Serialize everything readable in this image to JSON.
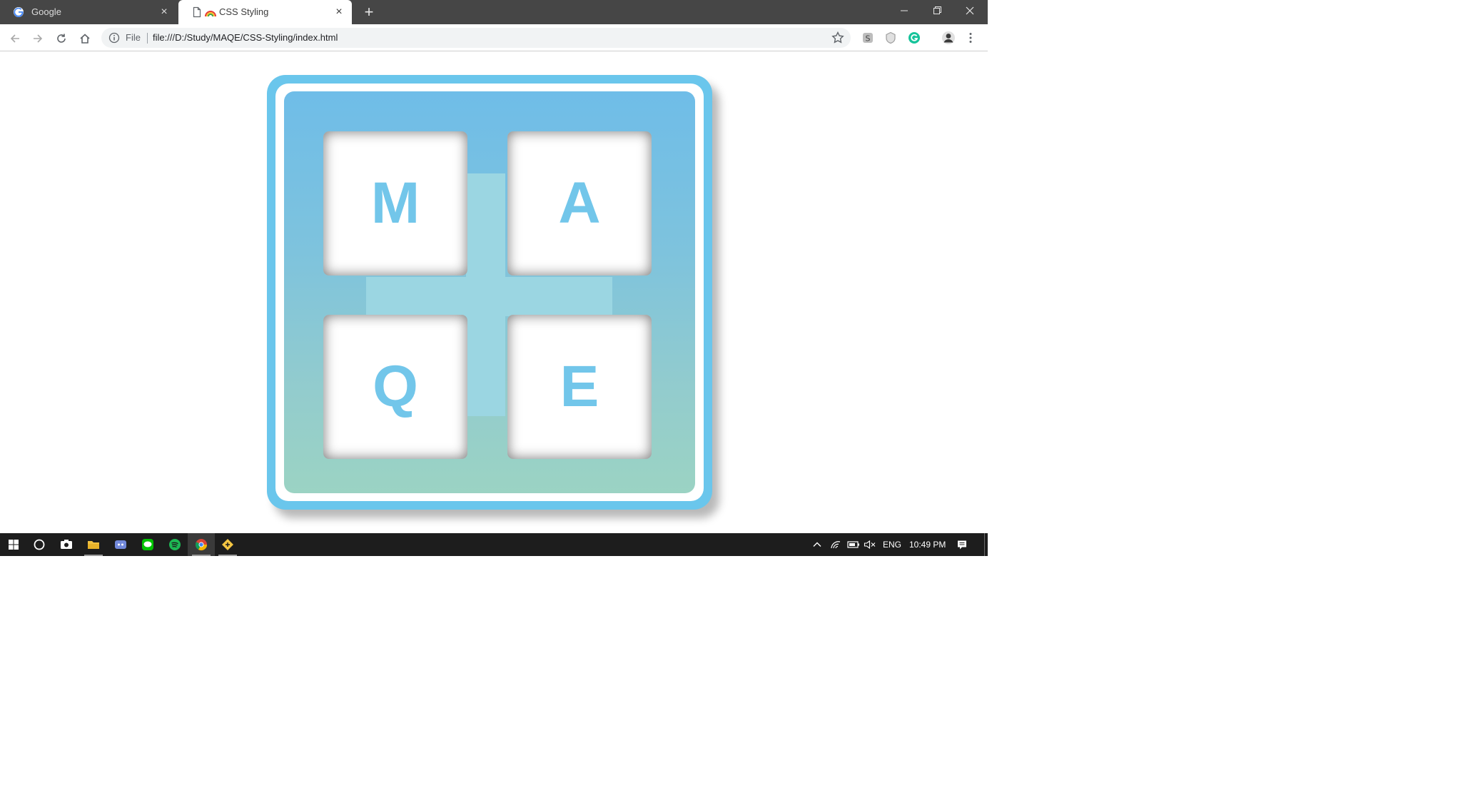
{
  "tabs": [
    {
      "title": "Google",
      "icon": "google-icon",
      "active": false
    },
    {
      "title": "CSS Styling",
      "icon": "rainbow-icon",
      "active": true
    }
  ],
  "toolbar": {
    "scheme_label": "File",
    "url": "file:///D:/Study/MAQE/CSS-Styling/index.html"
  },
  "grid": {
    "letters": [
      "M",
      "A",
      "Q",
      "E"
    ]
  },
  "taskbar": {
    "language": "ENG",
    "time": "10:49 PM"
  },
  "colors": {
    "frame": "#6ac6ec",
    "letter": "#72c6ea",
    "cross": "#9bd6e2",
    "gradient_top": "#6fbde8",
    "gradient_bottom": "#9bd3c3",
    "taskbar": "#1d1d1d",
    "titlebar": "#464646"
  }
}
